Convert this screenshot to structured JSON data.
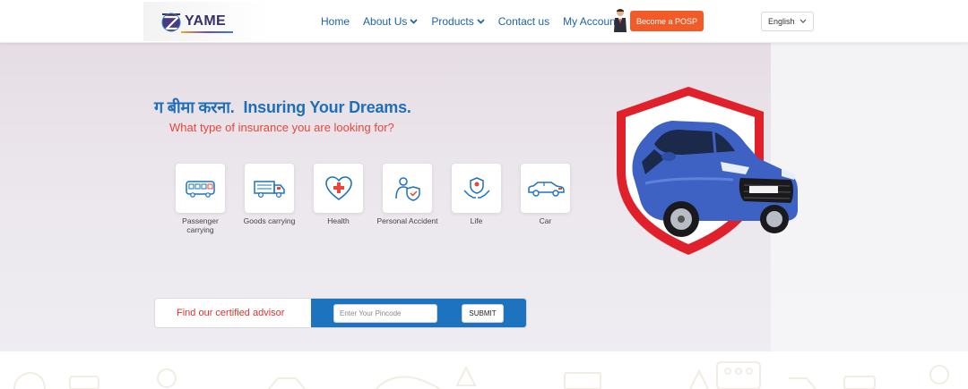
{
  "header": {
    "logo_text": "YAME",
    "nav": [
      {
        "label": "Home",
        "has_dropdown": false
      },
      {
        "label": "About Us",
        "has_dropdown": true
      },
      {
        "label": "Products",
        "has_dropdown": true
      },
      {
        "label": "Contact us",
        "has_dropdown": false
      },
      {
        "label": "My Account",
        "has_dropdown": false
      }
    ],
    "posp_button": "Become a POSP",
    "language": "English"
  },
  "hero": {
    "tagline_hindi": "ग बीमा करना.",
    "tagline_english": "Insuring Your Dreams.",
    "subtitle": "What type of insurance you are looking for?",
    "categories": [
      {
        "label": "Passenger carrying",
        "icon": "bus-icon"
      },
      {
        "label": "Goods carrying",
        "icon": "truck-icon"
      },
      {
        "label": "Health",
        "icon": "heart-cross-icon"
      },
      {
        "label": "Personal Accident",
        "icon": "person-shield-icon"
      },
      {
        "label": "Life",
        "icon": "hands-shield-icon"
      },
      {
        "label": "Car",
        "icon": "car-icon"
      }
    ]
  },
  "advisor": {
    "label": "Find our certified advisor",
    "pincode_placeholder": "Enter Your Pincode",
    "submit_label": "SUBMIT"
  },
  "colors": {
    "primary_blue": "#1d73bd",
    "accent_orange": "#f25a27",
    "accent_red": "#e0312a"
  }
}
